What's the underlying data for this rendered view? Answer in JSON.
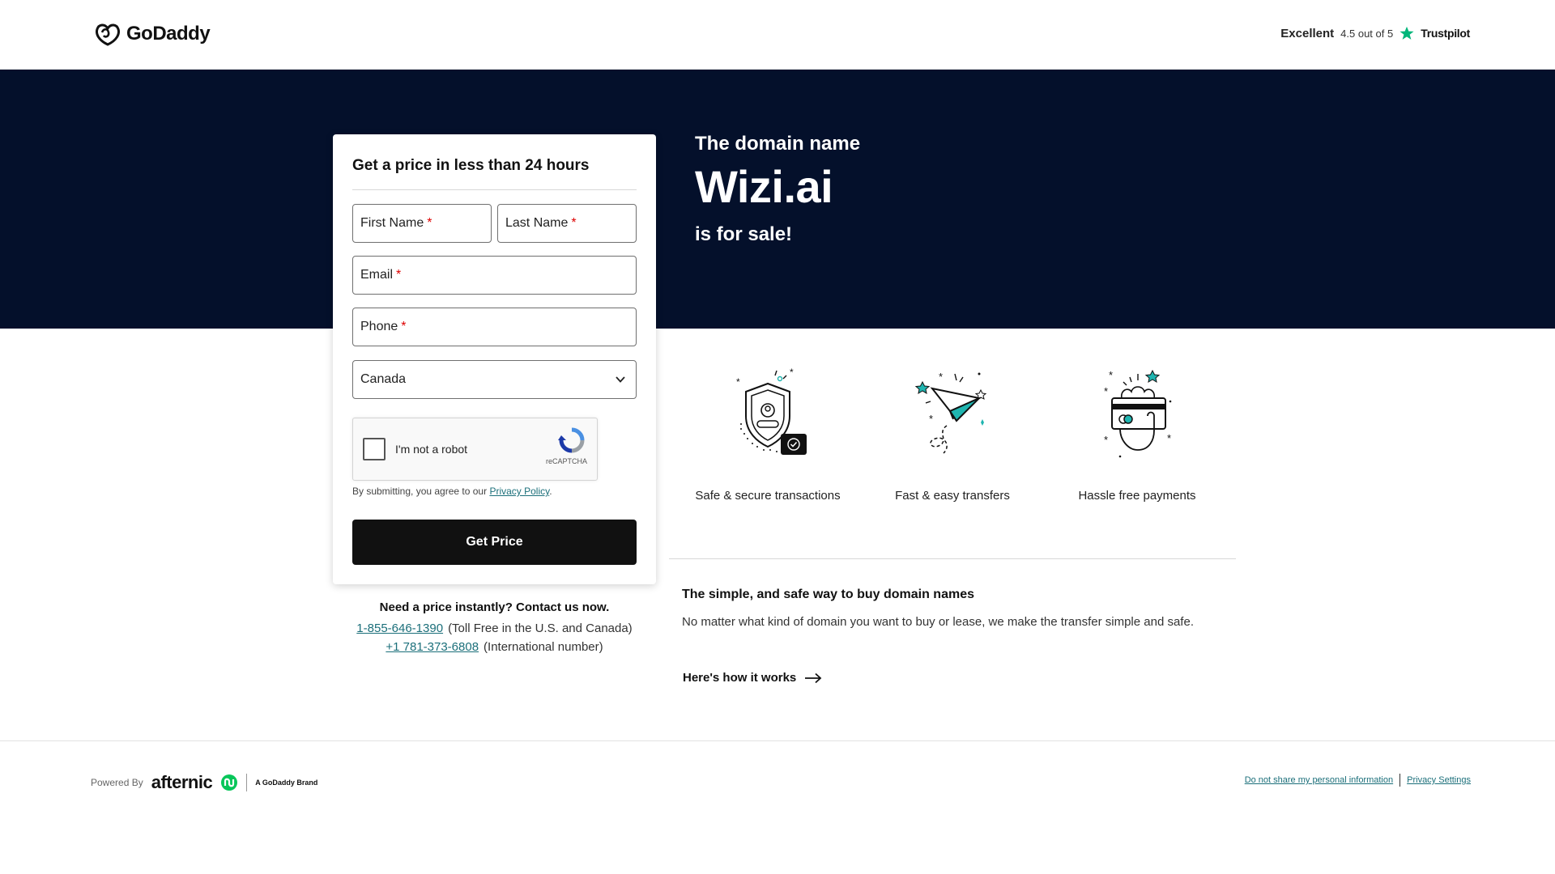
{
  "header": {
    "logo_text": "GoDaddy",
    "trust_excellent": "Excellent",
    "trust_rating": "4.5 out of 5",
    "trust_name": "Trustpilot"
  },
  "hero": {
    "subtitle": "The domain name",
    "domain": "Wizi.ai",
    "sale": "is for sale!"
  },
  "form": {
    "title": "Get a price in less than 24 hours",
    "first_name": "First Name",
    "last_name": "Last Name",
    "email": "Email",
    "phone": "Phone",
    "required_mark": "*",
    "country_value": "Canada",
    "recaptcha_label": "I'm not a robot",
    "recaptcha_brand": "reCAPTCHA",
    "consent_prefix": "By submitting, you agree to our ",
    "consent_link": "Privacy Policy",
    "consent_suffix": ".",
    "submit_label": "Get Price"
  },
  "contact": {
    "title": "Need a price instantly? Contact us now.",
    "toll_free_number": "1-855-646-1390",
    "toll_free_note": "(Toll Free in the U.S. and Canada)",
    "intl_number": "+1 781-373-6808",
    "intl_note": "(International number)"
  },
  "features": [
    {
      "label": "Safe & secure transactions",
      "icon": "shield-icon"
    },
    {
      "label": "Fast & easy transfers",
      "icon": "paper-plane-icon"
    },
    {
      "label": "Hassle free payments",
      "icon": "payment-card-icon"
    }
  ],
  "info": {
    "title": "The simple, and safe way to buy domain names",
    "text": "No matter what kind of domain you want to buy or lease, we make the transfer simple and safe.",
    "link": "Here's how it works"
  },
  "footer": {
    "powered_label": "Powered By",
    "afternic": "afternic",
    "brand_tag": "A GoDaddy Brand",
    "link_personal": "Do not share my personal information",
    "link_privacy": "Privacy Settings"
  },
  "colors": {
    "hero_bg": "#04102b",
    "link": "#1b6f7a",
    "button": "#111111",
    "accent_teal": "#1fb5b0"
  }
}
